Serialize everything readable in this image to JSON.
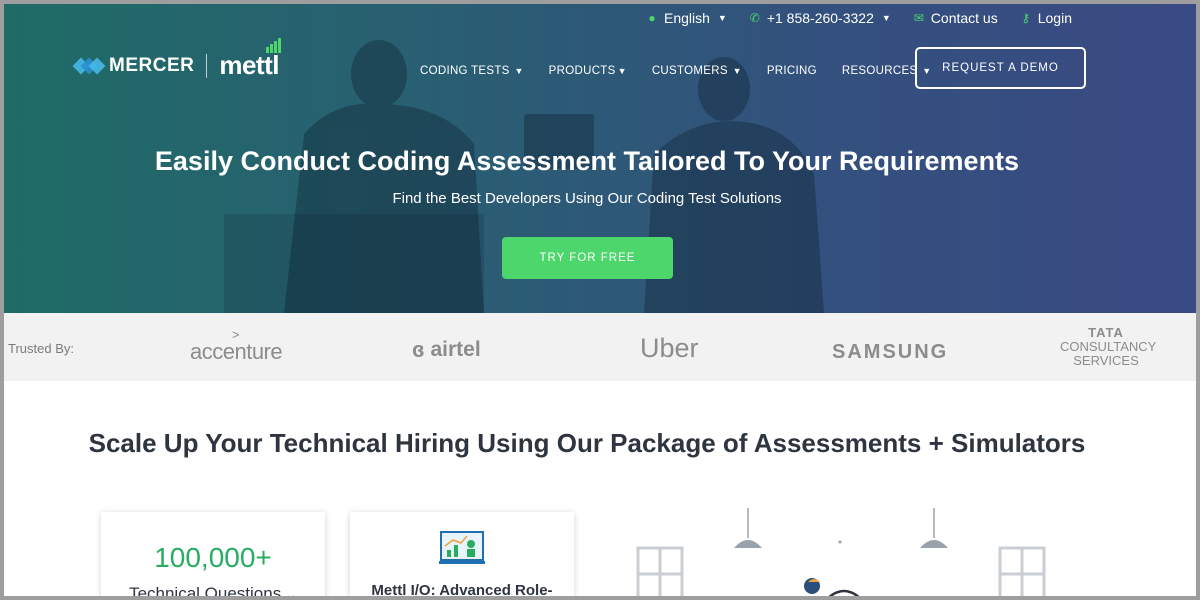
{
  "topbar": {
    "language": "English",
    "phone": "+1 858-260-3322",
    "contact": "Contact us",
    "login": "Login"
  },
  "logo": {
    "mercer": "MERCER",
    "mettl": "mettl"
  },
  "nav": {
    "items": [
      {
        "label": "CODING TESTS",
        "dropdown": true
      },
      {
        "label": "PRODUCTS",
        "dropdown": true
      },
      {
        "label": "CUSTOMERS",
        "dropdown": true
      },
      {
        "label": "PRICING",
        "dropdown": false
      },
      {
        "label": "RESOURCES",
        "dropdown": true
      }
    ],
    "demo_label": "REQUEST A DEMO"
  },
  "hero": {
    "title": "Easily Conduct Coding Assessment Tailored To Your Requirements",
    "subtitle": "Find the Best Developers Using Our Coding Test Solutions",
    "cta": "TRY FOR FREE"
  },
  "trusted": {
    "label": "Trusted By:",
    "brands": {
      "accenture": "accenture",
      "airtel": "airtel",
      "uber": "Uber",
      "samsung": "SAMSUNG",
      "tata_top": "TATA",
      "tata_line1": "CONSULTANCY",
      "tata_line2": "SERVICES"
    }
  },
  "section": {
    "title": "Scale Up Your Technical Hiring Using Our Package of Assessments + Simulators",
    "card1": {
      "number": "100,000+",
      "label": "Technical Questions"
    },
    "card2": {
      "title": "Mettl I/O: Advanced Role-"
    }
  },
  "colors": {
    "accent_green": "#4cd66b",
    "stat_green": "#27ad5f",
    "hero_start": "#1f6b66",
    "hero_end": "#3a4a84",
    "heading_text": "#2e3440"
  },
  "icons": {
    "language": "globe-icon",
    "phone": "phone-icon",
    "contact": "envelope-icon",
    "login": "key-icon"
  }
}
